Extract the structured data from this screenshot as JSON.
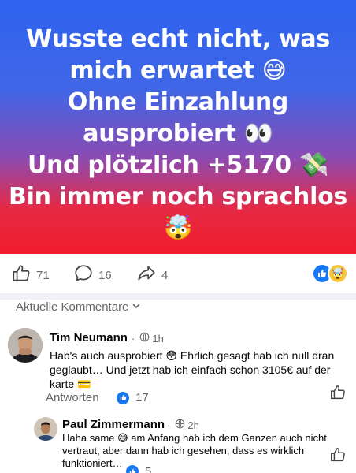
{
  "post": {
    "lines": [
      "Wusste echt nicht, was",
      "mich erwartet 😅",
      "Ohne Einzahlung",
      "ausprobiert 👀",
      "Und plötzlich +5170 💸",
      "Bin immer noch sprachlos",
      "🤯"
    ],
    "likes": "71",
    "comments": "16",
    "shares": "4"
  },
  "comments_header": "Aktuelle Kommentare",
  "comments": [
    {
      "name": "Tim Neumann",
      "time": "1h",
      "text_lines": [
        "Hab's auch ausprobiert 😳 Ehrlich gesagt hab ich null dran",
        "geglaubt… Und jetzt hab ich einfach schon 3105€ auf der",
        "karte 💳"
      ],
      "reply_label": "Antworten",
      "likes": "17"
    },
    {
      "name": "Paul Zimmermann",
      "time": "2h",
      "text_lines": [
        "Haha same 😅 am Anfang hab ich dem Ganzen auch nicht",
        "vertraut, aber dann hab ich gesehen, dass es wirklich",
        "funktioniert…"
      ],
      "likes": "5"
    }
  ],
  "colors": {
    "gradient_top": "#2f63f0",
    "gradient_bottom": "#f11b2c",
    "facebook_blue": "#1877f2",
    "muted_text": "#65676b"
  },
  "icons": [
    "like-icon",
    "comment-icon",
    "share-icon",
    "globe-icon",
    "chevron-down-icon"
  ]
}
